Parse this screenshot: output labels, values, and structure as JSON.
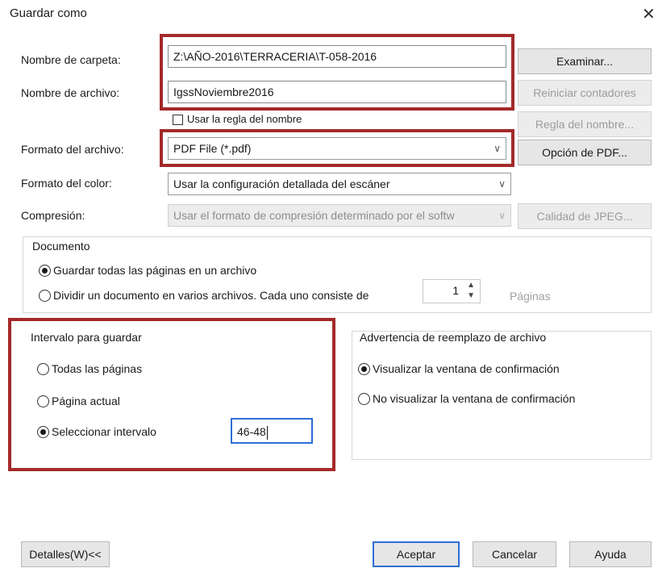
{
  "window": {
    "title": "Guardar como",
    "close": "✕"
  },
  "labels": {
    "folder": "Nombre de carpeta:",
    "file": "Nombre de archivo:",
    "format": "Formato del archivo:",
    "color": "Formato del color:",
    "compression": "Compresión:"
  },
  "fields": {
    "folder": "Z:\\AÑO-2016\\TERRACERIA\\T-058-2016",
    "file": "IgssNoviembre2016",
    "use_name_rule": "Usar la regla del nombre"
  },
  "selects": {
    "format": "PDF File (*.pdf)",
    "color": "Usar la configuración detallada del escáner",
    "compression": "Usar el formato de compresión determinado por el softw"
  },
  "buttons": {
    "browse": "Examinar...",
    "reset_counters": "Reiniciar contadores",
    "name_rule": "Regla del nombre...",
    "pdf_option": "Opción de PDF...",
    "jpeg_quality": "Calidad de JPEG...",
    "details": "Detalles(W)<<",
    "accept": "Aceptar",
    "cancel": "Cancelar",
    "help": "Ayuda"
  },
  "document": {
    "title": "Documento",
    "save_all": "Guardar todas las páginas en un archivo",
    "split": "Dividir un documento en varios archivos. Cada uno consiste de",
    "pages_count": "1",
    "pages_label": "Páginas"
  },
  "range": {
    "title": "Intervalo para guardar",
    "all": "Todas las páginas",
    "current": "Página actual",
    "select": "Seleccionar intervalo",
    "value": "46-48"
  },
  "overwrite": {
    "title": "Advertencia de reemplazo de archivo",
    "show": "Visualizar la ventana de confirmación",
    "hide": "No visualizar la ventana de confirmación"
  },
  "colors": {
    "highlight": "#a42a2a",
    "primary_border": "#2d6ed6"
  },
  "icons": {
    "dropdown": "chevron-down-icon",
    "spin_up": "spin-up-icon",
    "spin_down": "spin-down-icon"
  }
}
